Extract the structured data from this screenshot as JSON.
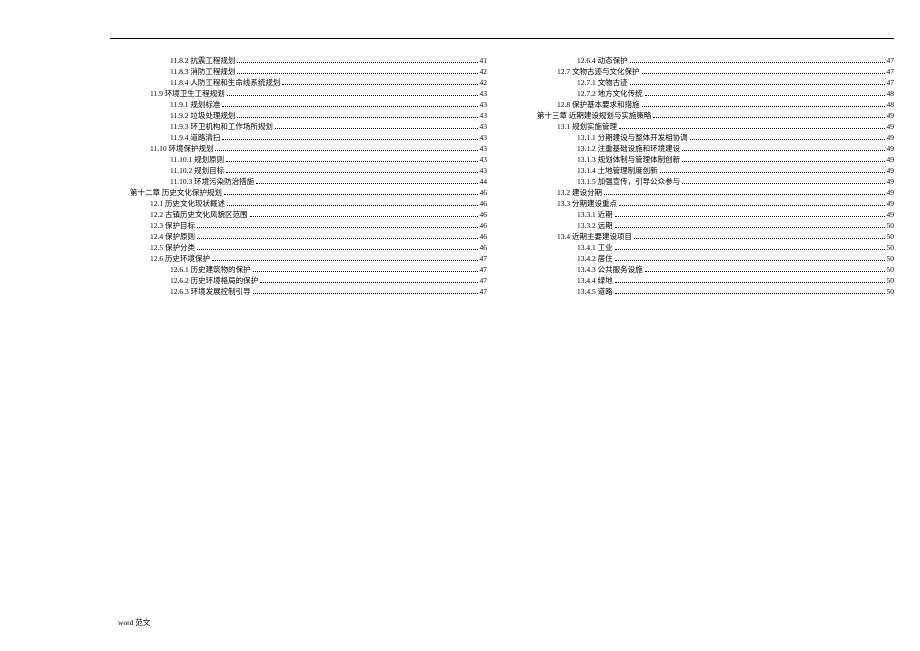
{
  "footer": "word 范文",
  "left": [
    {
      "indent": 3,
      "label": "11.8.2  抗震工程规划",
      "page": "41"
    },
    {
      "indent": 3,
      "label": "11.8.3  消防工程规划",
      "page": "42"
    },
    {
      "indent": 3,
      "label": "11.8.4  人防工程和生命线系统规划",
      "page": "42"
    },
    {
      "indent": 2,
      "label": "11.9  环境卫生工程规划",
      "page": "43"
    },
    {
      "indent": 3,
      "label": "11.9.1  规划标准",
      "page": "43"
    },
    {
      "indent": 3,
      "label": "11.9.2  垃圾处理规划",
      "page": "43"
    },
    {
      "indent": 3,
      "label": "11.9.3  环卫机构和工作场所规划",
      "page": "43"
    },
    {
      "indent": 3,
      "label": "11.9.4  道路清扫",
      "page": "43"
    },
    {
      "indent": 2,
      "label": "11.10  环境保护规划",
      "page": "43"
    },
    {
      "indent": 3,
      "label": "11.10.1  规划原则",
      "page": "43"
    },
    {
      "indent": 3,
      "label": "11.10.2  规划目标",
      "page": "43"
    },
    {
      "indent": 3,
      "label": "11.10.3  环境污染防治措施",
      "page": "44"
    },
    {
      "indent": 1,
      "label": "第十二章    历史文化保护规划",
      "page": "46"
    },
    {
      "indent": 2,
      "label": "12.1 历史文化现状概述",
      "page": "46"
    },
    {
      "indent": 2,
      "label": "12.2 古镇历史文化风貌区范围",
      "page": "46"
    },
    {
      "indent": 2,
      "label": "12.3 保护目标",
      "page": "46"
    },
    {
      "indent": 2,
      "label": "12.4  保护原则",
      "page": "46"
    },
    {
      "indent": 2,
      "label": "12.5 保护分类",
      "page": "46"
    },
    {
      "indent": 2,
      "label": "12.6 历史环境保护",
      "page": "47"
    },
    {
      "indent": 3,
      "label": "12.6.1 历史建筑物的保护",
      "page": "47"
    },
    {
      "indent": 3,
      "label": "12.6.2 历史环境格局的保护",
      "page": "47"
    },
    {
      "indent": 3,
      "label": "12.6.3 环境发展控制引导",
      "page": "47"
    }
  ],
  "right": [
    {
      "indent": 3,
      "label": "12.6.4 动态保护",
      "page": "47"
    },
    {
      "indent": 2,
      "label": "12.7 文物古迹与文化保护",
      "page": "47"
    },
    {
      "indent": 3,
      "label": "12.7.1 文物古迹",
      "page": "47"
    },
    {
      "indent": 3,
      "label": "12.7.2 地方文化传统",
      "page": "48"
    },
    {
      "indent": 2,
      "label": "12.8  保护基本要求和措施",
      "page": "48"
    },
    {
      "indent": 1,
      "label": "第十三章    近期建设规划与实施策略",
      "page": "49"
    },
    {
      "indent": 2,
      "label": "13.1 规划实施管理",
      "page": "49"
    },
    {
      "indent": 3,
      "label": "13.1.1 分期建设与整体开发相协调",
      "page": "49"
    },
    {
      "indent": 3,
      "label": "13.1.2 注重基础设施和环境建设",
      "page": "49"
    },
    {
      "indent": 3,
      "label": "13.1.3 规划体制与管理体制创新",
      "page": "49"
    },
    {
      "indent": 3,
      "label": "13.1.4 土地管理制度创新",
      "page": "49"
    },
    {
      "indent": 3,
      "label": "13.1.5  加强宣传，引导公众参与",
      "page": "49"
    },
    {
      "indent": 2,
      "label": "13.2  建设分期",
      "page": "49"
    },
    {
      "indent": 2,
      "label": "13.3   分期建设重点",
      "page": "49"
    },
    {
      "indent": 3,
      "label": "13.3.1  近期",
      "page": "49"
    },
    {
      "indent": 3,
      "label": "13.3.2  远期",
      "page": "50"
    },
    {
      "indent": 2,
      "label": "13.4    近期主要建设项目",
      "page": "50"
    },
    {
      "indent": 3,
      "label": "13.4.1  工业",
      "page": "50"
    },
    {
      "indent": 3,
      "label": "13.4.2  居住",
      "page": "50"
    },
    {
      "indent": 3,
      "label": "13.4.3  公共服务设施",
      "page": "50"
    },
    {
      "indent": 3,
      "label": "13.4.4  绿地",
      "page": "50"
    },
    {
      "indent": 3,
      "label": "13.4.5  道路",
      "page": "50"
    }
  ]
}
